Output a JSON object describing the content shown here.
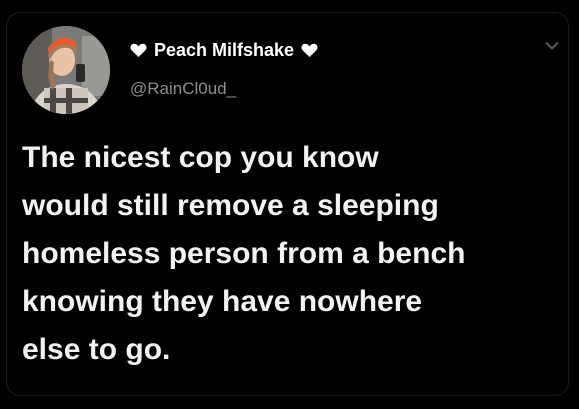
{
  "tweet": {
    "author": {
      "display_name": "Peach Milfshake",
      "handle": "@RainCl0ud_",
      "name_decoration_icon": "heart-icon",
      "avatar_icon": "profile-avatar"
    },
    "text_lines": [
      "The nicest cop you know",
      "would still remove a sleeping",
      "homeless person from a bench",
      "knowing they have nowhere",
      "else to go."
    ],
    "menu_icon": "chevron-down-icon"
  },
  "colors": {
    "background": "#000000",
    "text": "#f2f2f2",
    "handle": "#8a8d91"
  }
}
